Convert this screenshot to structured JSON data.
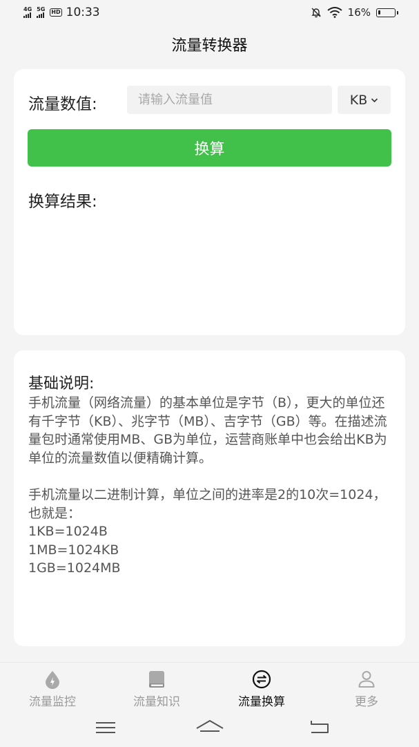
{
  "status_bar": {
    "network_1": "4G",
    "network_2": "5G",
    "hd_badge": "HD",
    "time": "10:33",
    "battery_text": "16%",
    "battery_level": 0.16
  },
  "header": {
    "title": "流量转换器"
  },
  "converter": {
    "value_label": "流量数值:",
    "input_placeholder": "请输入流量值",
    "input_value": "",
    "unit_selected": "KB",
    "convert_button": "换算",
    "result_label": "换算结果:"
  },
  "info": {
    "title": "基础说明:",
    "paragraph_1": "手机流量（网络流量）的基本单位是字节（B），更大的单位还有千字节（KB）、兆字节（MB）、吉字节（GB）等。在描述流量包时通常使用MB、GB为单位，运营商账单中也会给出KB为单位的流量数值以便精确计算。",
    "paragraph_2": "手机流量以二进制计算，单位之间的进率是2的10次=1024，也就是：",
    "line_1": "1KB=1024B",
    "line_2": "1MB=1024KB",
    "line_3": "1GB=1024MB"
  },
  "tabs": [
    {
      "label": "流量监控",
      "icon": "drop-icon",
      "active": false
    },
    {
      "label": "流量知识",
      "icon": "book-icon",
      "active": false
    },
    {
      "label": "流量换算",
      "icon": "exchange-icon",
      "active": true
    },
    {
      "label": "更多",
      "icon": "person-icon",
      "active": false
    }
  ],
  "colors": {
    "accent": "#41c04a",
    "background": "#f4f4f4",
    "card": "#ffffff"
  }
}
